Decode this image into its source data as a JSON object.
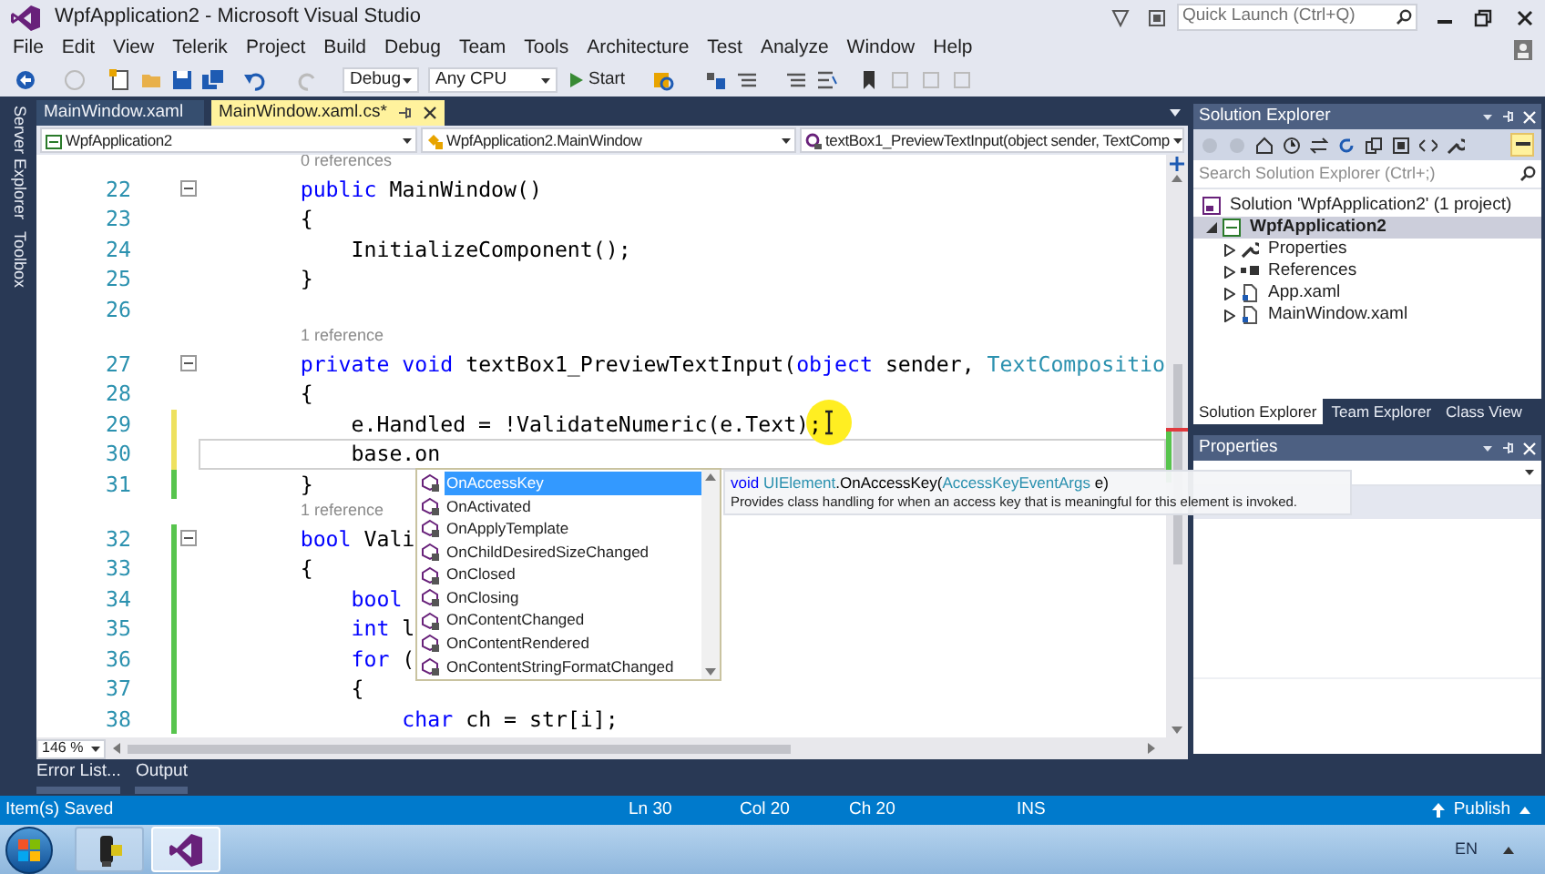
{
  "window": {
    "title": "WpfApplication2 - Microsoft Visual Studio",
    "quick_launch": {
      "placeholder": "Quick Launch (Ctrl+Q)"
    }
  },
  "menu": [
    "File",
    "Edit",
    "View",
    "Telerik",
    "Project",
    "Build",
    "Debug",
    "Team",
    "Tools",
    "Architecture",
    "Test",
    "Analyze",
    "Window",
    "Help"
  ],
  "toolbar": {
    "configuration": "Debug",
    "platform": "Any CPU",
    "start": "Start"
  },
  "side_tabs": [
    "Server Explorer",
    "Toolbox"
  ],
  "document_tabs": [
    {
      "label": "MainWindow.xaml",
      "selected": false
    },
    {
      "label": "MainWindow.xaml.cs*",
      "selected": true
    }
  ],
  "nav_bar": [
    "WpfApplication2",
    "WpfApplication2.MainWindow",
    "textBox1_PreviewTextInput(object sender, TextComp"
  ],
  "editor": {
    "lines": [
      {
        "kind": "lens",
        "text": "0 references"
      },
      {
        "kind": "code",
        "number": "22",
        "collapsed": false,
        "tokens": [
          {
            "kind": "keyword",
            "text": "        public"
          },
          {
            "kind": "plain",
            "text": " MainWindow()"
          }
        ]
      },
      {
        "kind": "code",
        "number": "23",
        "tokens": [
          {
            "kind": "plain",
            "text": "        {"
          }
        ]
      },
      {
        "kind": "code",
        "number": "24",
        "tokens": [
          {
            "kind": "plain",
            "text": "            InitializeComponent();"
          }
        ]
      },
      {
        "kind": "code",
        "number": "25",
        "tokens": [
          {
            "kind": "plain",
            "text": "        }"
          }
        ]
      },
      {
        "kind": "code",
        "number": "26"
      },
      {
        "kind": "lens",
        "text": "1 reference"
      },
      {
        "kind": "code",
        "number": "27",
        "collapsed": false,
        "tokens": [
          {
            "kind": "keyword",
            "text": "        private"
          },
          {
            "kind": "keyword",
            "text": " void"
          },
          {
            "kind": "plain",
            "text": " textBox1_PreviewTextInput("
          },
          {
            "kind": "keyword",
            "text": "object"
          },
          {
            "kind": "plain",
            "text": " sender, "
          },
          {
            "kind": "type",
            "text": "TextCompositio"
          }
        ]
      },
      {
        "kind": "code",
        "number": "28",
        "tokens": [
          {
            "kind": "plain",
            "text": "        {"
          }
        ]
      },
      {
        "kind": "code",
        "number": "29",
        "color": "#eee15f",
        "tokens": [
          {
            "kind": "plain",
            "text": "            e.Handled = !ValidateNumeric(e.Text);"
          }
        ]
      },
      {
        "kind": "code",
        "number": "30",
        "color": "#eee15f",
        "current": true,
        "tokens": [
          {
            "kind": "plain",
            "text": "            base.on"
          }
        ]
      },
      {
        "kind": "code",
        "number": "31",
        "color": "#57c44d",
        "tokens": [
          {
            "kind": "plain",
            "text": "        }"
          }
        ]
      },
      {
        "kind": "lens",
        "text": "1 reference"
      },
      {
        "kind": "code",
        "number": "32",
        "color": "#57c44d",
        "collapsed": false,
        "tokens": [
          {
            "kind": "keyword",
            "text": "        bool"
          },
          {
            "kind": "plain",
            "text": " Vali"
          }
        ]
      },
      {
        "kind": "code",
        "number": "33",
        "color": "#57c44d",
        "tokens": [
          {
            "kind": "plain",
            "text": "        {"
          }
        ]
      },
      {
        "kind": "code",
        "number": "34",
        "color": "#57c44d",
        "tokens": [
          {
            "kind": "keyword",
            "text": "            bool"
          }
        ]
      },
      {
        "kind": "code",
        "number": "35",
        "color": "#57c44d",
        "tokens": [
          {
            "kind": "keyword",
            "text": "            int"
          },
          {
            "kind": "plain",
            "text": " l"
          }
        ]
      },
      {
        "kind": "code",
        "number": "36",
        "color": "#57c44d",
        "tokens": [
          {
            "kind": "keyword",
            "text": "            for"
          },
          {
            "kind": "plain",
            "text": " ("
          }
        ]
      },
      {
        "kind": "code",
        "number": "37",
        "color": "#57c44d",
        "tokens": [
          {
            "kind": "plain",
            "text": "            {"
          }
        ]
      },
      {
        "kind": "code",
        "number": "38",
        "color": "#57c44d",
        "tokens": [
          {
            "kind": "keyword",
            "text": "                char"
          },
          {
            "kind": "plain",
            "text": " ch = str[i];"
          }
        ]
      }
    ],
    "zoom": "146 %",
    "autocomplete": {
      "items": [
        {
          "label": "OnAccessKey",
          "selected": true
        },
        {
          "label": "OnActivated",
          "selected": false
        },
        {
          "label": "OnApplyTemplate",
          "selected": false
        },
        {
          "label": "OnChildDesiredSizeChanged",
          "selected": false
        },
        {
          "label": "OnClosed",
          "selected": false
        },
        {
          "label": "OnClosing",
          "selected": false
        },
        {
          "label": "OnContentChanged",
          "selected": false
        },
        {
          "label": "OnContentRendered",
          "selected": false
        },
        {
          "label": "OnContentStringFormatChanged",
          "selected": false
        }
      ],
      "tooltip": {
        "signature": [
          {
            "kind": "keyword",
            "text": "void"
          },
          {
            "kind": "type",
            "text": " UIElement"
          },
          {
            "kind": "plain",
            "text": ".OnAccessKey("
          },
          {
            "kind": "type",
            "text": "AccessKeyEventArgs"
          },
          {
            "kind": "plain",
            "text": " e)"
          }
        ],
        "description": "Provides class handling for when an access key that is meaningful for this element is invoked."
      }
    }
  },
  "bottom_tabs": [
    "Error List...",
    "Output"
  ],
  "solution_explorer": {
    "title": "Solution Explorer",
    "search": {
      "placeholder": "Search Solution Explorer (Ctrl+;)"
    },
    "tree": [
      {
        "label": "Solution 'WpfApplication2' (1 project)",
        "kind": "solution",
        "selected": false,
        "children": [
          {
            "label": "WpfApplication2",
            "kind": "project",
            "expanded": true,
            "selected": true,
            "children": [
              {
                "label": "Properties",
                "kind": "properties",
                "expanded": false,
                "selected": false
              },
              {
                "label": "References",
                "kind": "references",
                "expanded": false,
                "selected": false
              },
              {
                "label": "App.xaml",
                "kind": "file",
                "expanded": false,
                "selected": false
              },
              {
                "label": "MainWindow.xaml",
                "kind": "file",
                "expanded": false,
                "selected": false
              }
            ]
          }
        ]
      }
    ],
    "tabs": [
      {
        "label": "Solution Explorer",
        "selected": true
      },
      {
        "label": "Team Explorer",
        "selected": false
      },
      {
        "label": "Class View",
        "selected": false
      }
    ]
  },
  "properties": {
    "title": "Properties"
  },
  "status_bar": {
    "message": "Item(s) Saved",
    "line": "Ln 30",
    "column": "Col 20",
    "char": "Ch 20",
    "mode": "INS",
    "publish": "Publish"
  },
  "taskbar": {
    "apps": [
      {
        "kind": "device",
        "selected": false
      },
      {
        "kind": "studio",
        "selected": true
      }
    ],
    "language": "EN"
  }
}
